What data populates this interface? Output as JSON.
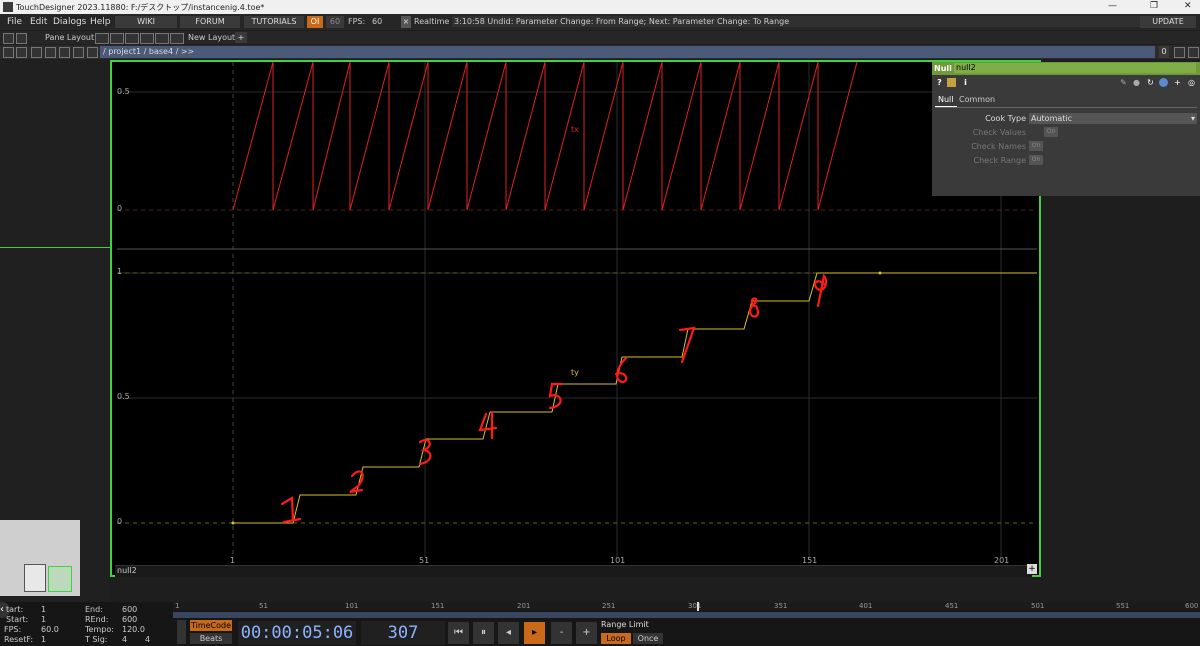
{
  "window": {
    "title": "TouchDesigner 2023.11880: F:/デスクトップ/instancenig.4.toe*",
    "minimize": "—",
    "restore": "❐",
    "close": "✕"
  },
  "menu": [
    "File",
    "Edit",
    "Dialogs",
    "Help"
  ],
  "toolbar": {
    "wiki": "WIKI",
    "forum": "FORUM",
    "tutorials": "TUTORIALS",
    "oi": "OI",
    "sixty": "60",
    "fps_label": "FPS:",
    "fps_value": "60",
    "realtime": "Realtime",
    "undo_text": "3:10:58 Undid: Parameter Change: From Range; Next: Parameter Change: To Range",
    "update": "UPDATE"
  },
  "panebar": {
    "pane_layout": "Pane Layout",
    "new_layout": "New Layout",
    "plus": "+"
  },
  "path": {
    "text": "/ project1 / base4 / >>",
    "count": "0"
  },
  "graph": {
    "node_name": "null2",
    "top_labels": {
      "y05": "0.5",
      "y0": "0"
    },
    "bottom_labels": {
      "y1": "1",
      "y05": "0.5",
      "y0": "0"
    },
    "channel_tx": "tx",
    "channel_ty": "ty",
    "x_ticks": [
      "1",
      "51",
      "101",
      "151",
      "201"
    ],
    "annotations": [
      "1",
      "2",
      "3",
      "4",
      "5",
      "6",
      "7",
      "8",
      "9"
    ],
    "plus": "+"
  },
  "params": {
    "op_type": "Null",
    "op_name": "null2",
    "tabs": [
      "Null",
      "Common"
    ],
    "cook_type_label": "Cook Type",
    "cook_type_value": "Automatic",
    "check_values": "Check Values",
    "check_names": "Check Names",
    "check_range": "Check Range",
    "toggle_off": "On"
  },
  "timeline": {
    "ruler": [
      "1",
      "51",
      "101",
      "151",
      "201",
      "251",
      "301",
      "351",
      "401",
      "451",
      "501",
      "551",
      "600"
    ],
    "start_label": "tart:",
    "start_value": "1",
    "rstart_label": "Start:",
    "rstart_value": "1",
    "fps_label": "FPS:",
    "fps_value": "60.0",
    "resetf_label": "ResetF:",
    "resetf_value": "1",
    "end_label": "End:",
    "end_value": "600",
    "rend_label": "REnd:",
    "rend_value": "600",
    "tempo_label": "Tempo:",
    "tempo_value": "120.0",
    "tsig_label": "T Sig:",
    "tsig_a": "4",
    "tsig_b": "4",
    "timecode_label": "TimeCode",
    "beats_label": "Beats",
    "timecode": "00:00:05:06",
    "frame": "307",
    "range_limit": "Range Limit",
    "loop": "Loop",
    "once": "Once"
  },
  "colors": {
    "accent": "#c86a1a",
    "node_border": "#3fd43f",
    "tx_curve": "#e02020",
    "ty_curve": "#d8c030",
    "annotation": "#ff1a1a"
  }
}
